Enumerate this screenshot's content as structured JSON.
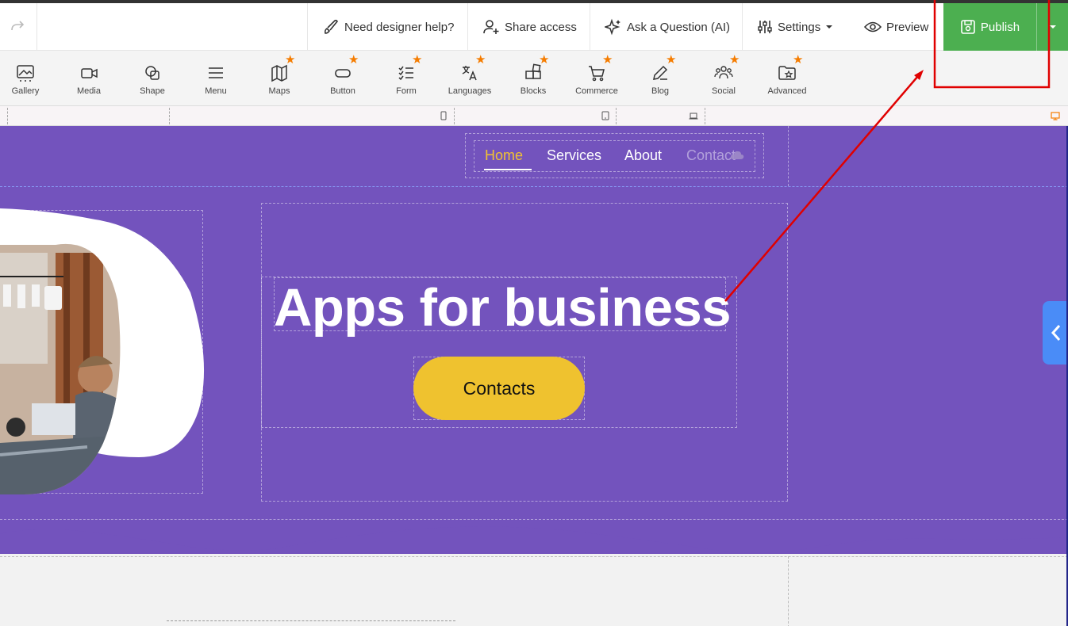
{
  "topbar": {
    "designer_help": "Need designer help?",
    "share_access": "Share access",
    "ask_question": "Ask a Question (AI)",
    "settings": "Settings",
    "preview": "Preview",
    "publish": "Publish"
  },
  "toolbar": {
    "items": [
      {
        "label": "Gallery",
        "icon": "gallery-icon",
        "premium": false
      },
      {
        "label": "Media",
        "icon": "video-icon",
        "premium": false
      },
      {
        "label": "Shape",
        "icon": "shape-icon",
        "premium": false
      },
      {
        "label": "Menu",
        "icon": "menu-icon",
        "premium": false
      },
      {
        "label": "Maps",
        "icon": "map-icon",
        "premium": true
      },
      {
        "label": "Button",
        "icon": "button-icon",
        "premium": true
      },
      {
        "label": "Form",
        "icon": "form-icon",
        "premium": true
      },
      {
        "label": "Languages",
        "icon": "translate-icon",
        "premium": true
      },
      {
        "label": "Blocks",
        "icon": "blocks-icon",
        "premium": true
      },
      {
        "label": "Commerce",
        "icon": "cart-icon",
        "premium": true
      },
      {
        "label": "Blog",
        "icon": "edit-icon",
        "premium": true
      },
      {
        "label": "Social",
        "icon": "people-icon",
        "premium": true
      },
      {
        "label": "Advanced",
        "icon": "folder-star-icon",
        "premium": true
      }
    ]
  },
  "site": {
    "nav": {
      "home": "Home",
      "services": "Services",
      "about": "About",
      "contact": "Contact"
    },
    "headline": "Apps for business",
    "cta": "Contacts"
  },
  "colors": {
    "hero_bg": "#7353bd",
    "accent_yellow": "#efc22f",
    "publish_green": "#4caf50",
    "annotation_red": "#e00000",
    "side_tab_blue": "#4a8cf7",
    "premium_star": "#f57c00"
  }
}
